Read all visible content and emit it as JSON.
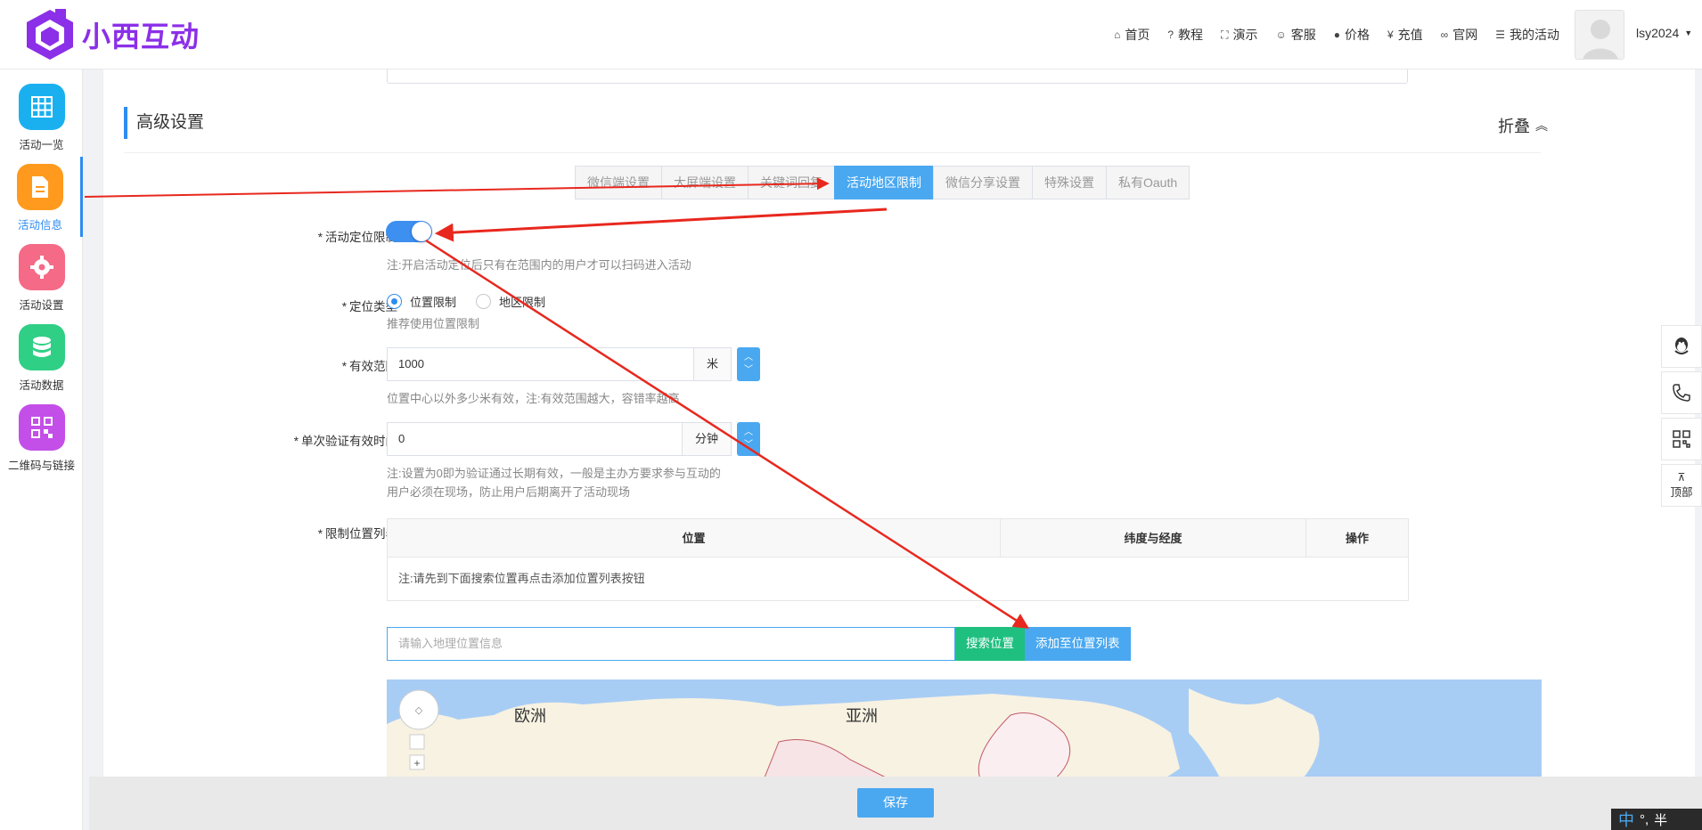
{
  "brand": {
    "name": "小西互动",
    "color": "#8b2fe8"
  },
  "nav": [
    {
      "icon": "home-icon",
      "glyph": "⌂",
      "label": "首页"
    },
    {
      "icon": "help-icon",
      "glyph": "?",
      "label": "教程"
    },
    {
      "icon": "fullscreen-icon",
      "glyph": "⛶",
      "label": "演示"
    },
    {
      "icon": "smile-icon",
      "glyph": "☺",
      "label": "客服"
    },
    {
      "icon": "info-icon",
      "glyph": "●",
      "label": "价格"
    },
    {
      "icon": "yen-icon",
      "glyph": "¥",
      "label": "充值"
    },
    {
      "icon": "link-icon",
      "glyph": "∞",
      "label": "官网"
    },
    {
      "icon": "list-icon",
      "glyph": "☰",
      "label": "我的活动"
    }
  ],
  "user": {
    "name": "lsy2024"
  },
  "sidebar": [
    {
      "label": "活动一览",
      "icon": "grid-icon",
      "color": "#1ab0f0"
    },
    {
      "label": "活动信息",
      "icon": "document-icon",
      "color": "#ff9a1e",
      "active": true
    },
    {
      "label": "活动设置",
      "icon": "gear-icon",
      "color": "#f56a86"
    },
    {
      "label": "活动数据",
      "icon": "database-icon",
      "color": "#2fcf86"
    },
    {
      "label": "二维码与链接",
      "icon": "qrcode-icon",
      "color": "#c34fe8"
    }
  ],
  "section": {
    "title": "高级设置",
    "fold_label": "折叠"
  },
  "tabs": [
    "微信端设置",
    "大屏端设置",
    "关键词回复",
    "活动地区限制",
    "微信分享设置",
    "特殊设置",
    "私有Oauth"
  ],
  "active_tab": 3,
  "form": {
    "location_limit": {
      "label": "活动定位限制",
      "enabled": true,
      "hint": "注:开启活动定位后只有在范围内的用户才可以扫码进入活动"
    },
    "location_type": {
      "label": "定位类型",
      "options": [
        "位置限制",
        "地区限制"
      ],
      "selected": 0,
      "hint": "推荐使用位置限制"
    },
    "range": {
      "label": "有效范围",
      "value": "1000",
      "unit": "米",
      "hint": "位置中心以外多少米有效，注:有效范围越大，容错率越高"
    },
    "validity": {
      "label": "单次验证有效时间",
      "value": "0",
      "unit": "分钟",
      "hint_line1": "注:设置为0即为验证通过长期有效，一般是主办方要求参与互动的",
      "hint_line2": "用户必须在现场，防止用户后期离开了活动现场"
    },
    "location_list": {
      "label": "限制位置列表",
      "columns": [
        "位置",
        "纬度与经度",
        "操作"
      ],
      "empty_note": "注:请先到下面搜索位置再点击添加位置列表按钮"
    }
  },
  "search": {
    "placeholder": "请输入地理位置信息",
    "search_button": "搜索位置",
    "add_button": "添加至位置列表"
  },
  "map": {
    "labels": [
      "欧洲",
      "亚洲"
    ]
  },
  "float_bar": [
    {
      "icon": "qq-icon",
      "label": ""
    },
    {
      "icon": "phone-icon",
      "label": ""
    },
    {
      "icon": "qrcode-small-icon",
      "label": ""
    },
    {
      "icon": "top-icon",
      "label": "顶部"
    }
  ],
  "footer": {
    "save_label": "保存"
  },
  "ime": {
    "lang": "中",
    "punct": "°,",
    "width": "半"
  }
}
